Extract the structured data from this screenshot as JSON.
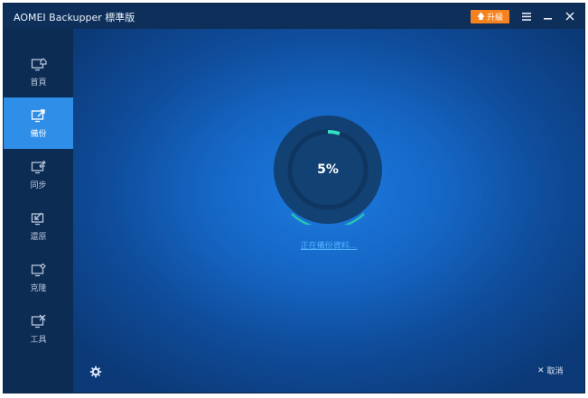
{
  "window": {
    "title": "AOMEI Backupper 標準版",
    "upgrade_label": "升級",
    "menu_icon": "menu-icon",
    "minimize_icon": "minimize-icon",
    "close_icon": "close-icon"
  },
  "sidebar": {
    "items": [
      {
        "label": "首頁",
        "icon": "home-icon",
        "active": false
      },
      {
        "label": "備份",
        "icon": "backup-icon",
        "active": true
      },
      {
        "label": "同步",
        "icon": "sync-icon",
        "active": false
      },
      {
        "label": "還原",
        "icon": "restore-icon",
        "active": false
      },
      {
        "label": "克隆",
        "icon": "clone-icon",
        "active": false
      },
      {
        "label": "工具",
        "icon": "tools-icon",
        "active": false
      }
    ]
  },
  "progress": {
    "percent_label": "5%",
    "value": 0.05,
    "status_text": "正在備份資料..."
  },
  "footer": {
    "settings_icon": "gear-icon",
    "cancel_label": "取消"
  },
  "colors": {
    "accent_active": "#2f8ee8",
    "upgrade": "#f5821f",
    "progress": "#35e0c0",
    "link": "#4fb4ff"
  }
}
